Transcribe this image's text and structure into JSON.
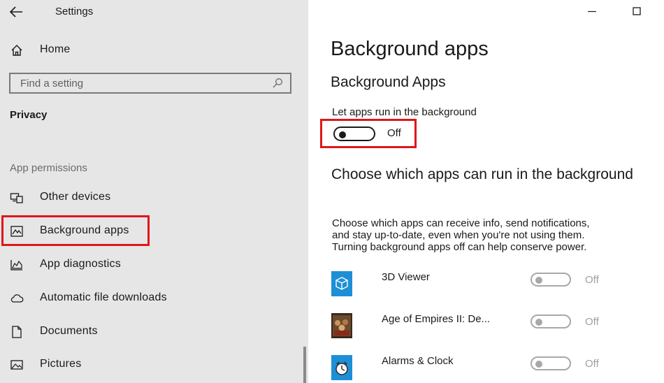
{
  "window": {
    "app_title": "Settings",
    "back_icon": "arrow-left-icon",
    "minimize_icon": "minimize-icon",
    "maximize_icon": "maximize-icon"
  },
  "sidebar": {
    "home": {
      "label": "Home",
      "icon": "home-icon"
    },
    "search": {
      "placeholder": "Find a setting",
      "icon": "search-icon"
    },
    "section_title": "Privacy",
    "group_label": "App permissions",
    "items": [
      {
        "label": "Other devices",
        "icon": "devices-icon",
        "selected": false
      },
      {
        "label": "Background apps",
        "icon": "background-apps-icon",
        "selected": true
      },
      {
        "label": "App diagnostics",
        "icon": "diagnostics-icon",
        "selected": false
      },
      {
        "label": "Automatic file downloads",
        "icon": "cloud-icon",
        "selected": false
      },
      {
        "label": "Documents",
        "icon": "document-icon",
        "selected": false
      },
      {
        "label": "Pictures",
        "icon": "pictures-icon",
        "selected": false
      }
    ]
  },
  "main": {
    "title": "Background apps",
    "subheading": "Background Apps",
    "toggle_caption": "Let apps run in the background",
    "main_toggle": {
      "state": "Off"
    },
    "section_title": "Choose which apps can run in the background",
    "description_lines": [
      "Choose which apps can receive info, send notifications,",
      "and stay up-to-date, even when you're not using them.",
      "Turning background apps off can help conserve power."
    ],
    "apps": [
      {
        "name": "3D Viewer",
        "icon": "3d-viewer-icon",
        "state": "Off"
      },
      {
        "name": "Age of Empires II: De...",
        "icon": "age-of-empires-icon",
        "state": "Off"
      },
      {
        "name": "Alarms & Clock",
        "icon": "alarms-clock-icon",
        "state": "Off"
      }
    ]
  },
  "colors": {
    "sidebar_bg": "#e6e6e6",
    "highlight_red": "#e0161a",
    "tile_blue": "#1e8fd6",
    "disabled_gray": "#a8a8a8"
  }
}
